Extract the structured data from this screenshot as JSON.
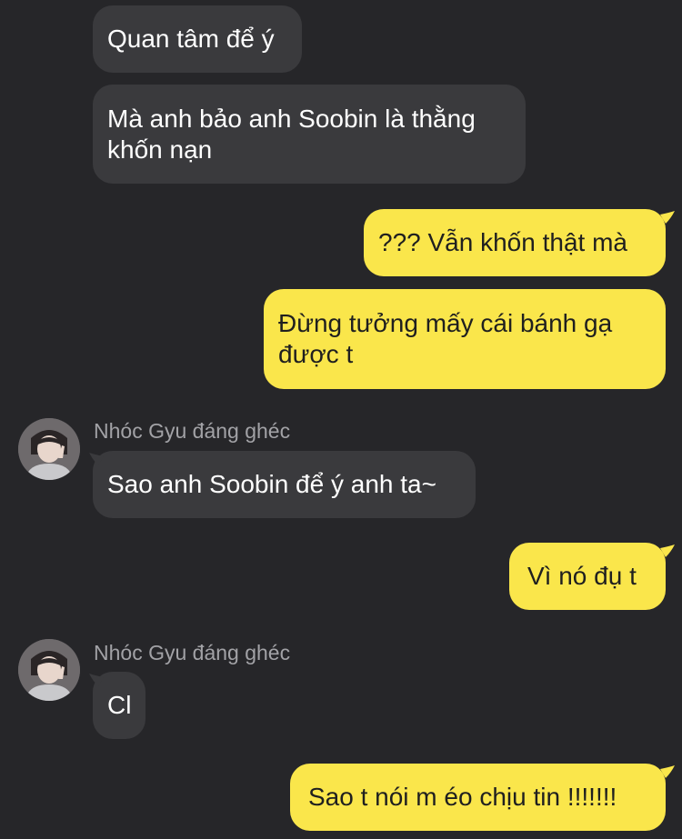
{
  "colors": {
    "background": "#262629",
    "incoming_bubble": "#3a3a3d",
    "outgoing_bubble": "#fae64b",
    "sender_name": "#a2a2a6"
  },
  "messages": [
    {
      "direction": "incoming",
      "text": "Quan tâm để ý"
    },
    {
      "direction": "incoming",
      "text": "Mà anh bảo anh Soobin là thằng\nkhốn nạn"
    },
    {
      "direction": "outgoing",
      "text": "??? Vẫn khốn thật mà"
    },
    {
      "direction": "outgoing",
      "text": "Đừng tưởng mấy cái bánh gạ\nđược t"
    },
    {
      "direction": "incoming",
      "sender": "Nhóc Gyu đáng ghéc",
      "avatar_icon": "user-avatar",
      "text": "Sao anh Soobin để ý anh ta~"
    },
    {
      "direction": "outgoing",
      "text": "Vì nó đụ t"
    },
    {
      "direction": "incoming",
      "sender": "Nhóc Gyu đáng ghéc",
      "avatar_icon": "user-avatar",
      "text": "Cl"
    },
    {
      "direction": "outgoing",
      "text": "Sao t nói m éo chịu tin !!!!!!!"
    }
  ]
}
